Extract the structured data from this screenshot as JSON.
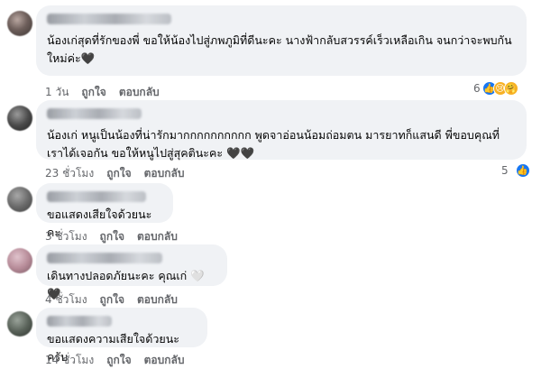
{
  "comments": [
    {
      "text": "น้องเก่สุดที่รักของพี่ ขอให้น้องไปสู่ภพภูมิที่ดีนะคะ นางฟ้ากลับสวรรค์เร็วเหลือเกิน จนกว่าจะพบกันใหม่ค่ะ🖤",
      "time": "1 วัน",
      "like": "ถูกใจ",
      "reply": "ตอบกลับ",
      "reaction_count": "6",
      "reaction_icons": [
        "like-icon",
        "sad-icon",
        "care-icon"
      ]
    },
    {
      "text": "น้องเก่ หนูเป็นน้องที่น่ารักมากกกกกกกกกก พูดจาอ่อนน้อมถ่อมตน มารยาทก็แสนดี พี่ขอบคุณที่เราได้เจอกัน ขอให้หนูไปสู่สุคตินะคะ 🖤🖤",
      "time": "23 ชั่วโมง",
      "like": "ถูกใจ",
      "reply": "ตอบกลับ",
      "reaction_count": "5",
      "reaction_icons": [
        "like-icon"
      ]
    },
    {
      "text": "ขอแสดงเสียใจด้วยนะคะ",
      "time": "3 ชั่วโมง",
      "like": "ถูกใจ",
      "reply": "ตอบกลับ"
    },
    {
      "text": "เดินทางปลอดภัยนะคะ คุณเก่ 🤍🖤",
      "time": "4 ชั่วโมง",
      "like": "ถูกใจ",
      "reply": "ตอบกลับ"
    },
    {
      "text": "ขอแสดงความเสียใจด้วยนะครับ",
      "time": "14 ชั่วโมง",
      "like": "ถูกใจ",
      "reply": "ตอบกลับ"
    }
  ],
  "colors": {
    "bubble": "#f0f2f5",
    "meta_text": "#65676b",
    "like_blue": "#1877f2"
  }
}
